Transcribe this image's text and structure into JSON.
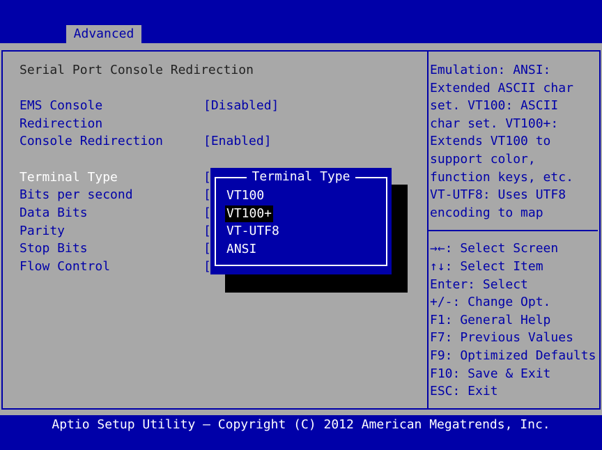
{
  "tabs": [
    {
      "label": "Advanced",
      "active": true
    }
  ],
  "main": {
    "section_title": "Serial Port Console Redirection",
    "items": [
      {
        "label": "EMS Console",
        "label2": "Redirection",
        "value": "[Disabled]"
      },
      {
        "label": "Console Redirection",
        "value": "[Enabled]"
      },
      {
        "label": "Terminal Type",
        "value": "["
      },
      {
        "label": "Bits per second",
        "value": "["
      },
      {
        "label": "Data Bits",
        "value": "["
      },
      {
        "label": "Parity",
        "value": "["
      },
      {
        "label": "Stop Bits",
        "value": "["
      },
      {
        "label": "Flow Control",
        "value": "["
      }
    ]
  },
  "popup": {
    "title": "Terminal Type",
    "options": [
      "VT100",
      "VT100+",
      "VT-UTF8",
      "ANSI"
    ],
    "selected": "VT100+"
  },
  "help": {
    "lines": [
      "Emulation: ANSI:",
      "Extended ASCII char",
      "set. VT100: ASCII",
      "char set. VT100+:",
      "Extends VT100 to",
      "support color,",
      "function keys, etc.",
      "VT-UTF8: Uses UTF8",
      "encoding to map"
    ]
  },
  "keys": [
    "→←: Select Screen",
    "↑↓: Select Item",
    "Enter: Select",
    "+/-: Change Opt.",
    "F1: General Help",
    "F7: Previous Values",
    "F9: Optimized Defaults",
    "F10: Save & Exit",
    "ESC: Exit"
  ],
  "footer": "Aptio Setup Utility – Copyright (C) 2012 American Megatrends, Inc.",
  "colors": {
    "blue": "#0000a8",
    "gray": "#a8a8a8"
  }
}
